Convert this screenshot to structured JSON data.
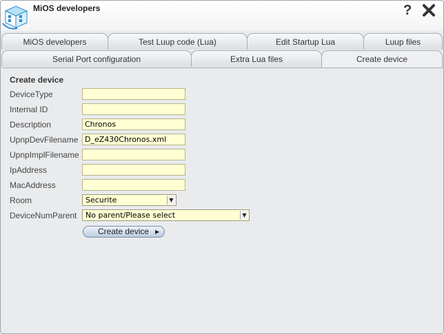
{
  "window": {
    "title": "MiOS developers"
  },
  "tabs_row1": [
    {
      "label": "MiOS developers"
    },
    {
      "label": "Test Luup code (Lua)"
    },
    {
      "label": "Edit Startup Lua"
    },
    {
      "label": "Luup files"
    }
  ],
  "tabs_row2": [
    {
      "label": "Serial Port configuration"
    },
    {
      "label": "Extra Lua files"
    },
    {
      "label": "Create device",
      "active": true
    }
  ],
  "form": {
    "title": "Create device",
    "fields": [
      {
        "label": "DeviceType",
        "value": ""
      },
      {
        "label": "Internal ID",
        "value": ""
      },
      {
        "label": "Description",
        "value": "Chronos"
      },
      {
        "label": "UpnpDevFilename",
        "value": "D_eZ430Chronos.xml"
      },
      {
        "label": "UpnpImplFilename",
        "value": ""
      },
      {
        "label": "IpAddress",
        "value": ""
      },
      {
        "label": "MacAddress",
        "value": ""
      }
    ],
    "room": {
      "label": "Room",
      "selected": "Securite"
    },
    "parent": {
      "label": "DeviceNumParent",
      "selected": "No parent/Please select"
    },
    "submit_label": "Create device"
  },
  "icons": {
    "help": "question-mark-icon",
    "close": "close-icon",
    "logo": "mios-logo"
  }
}
